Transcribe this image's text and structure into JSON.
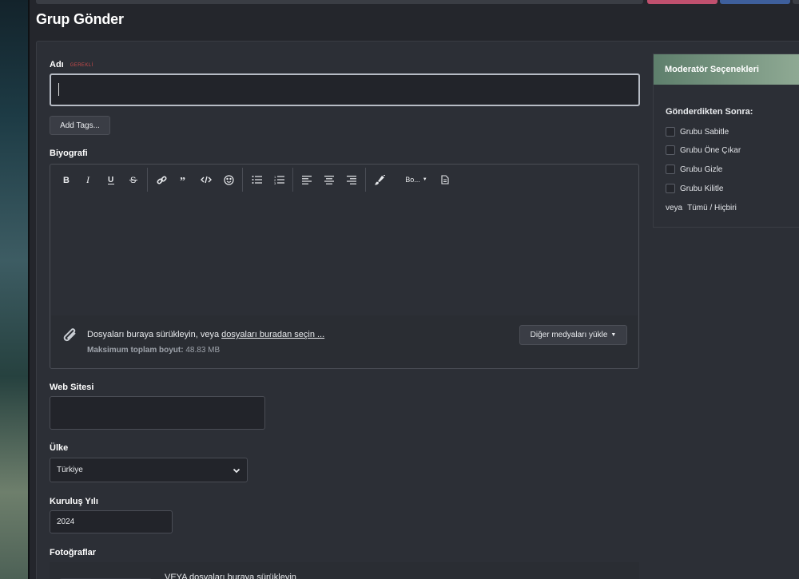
{
  "page": {
    "title": "Grup Gönder"
  },
  "form": {
    "name": {
      "label": "Adı",
      "required": "GEREKLİ",
      "value": ""
    },
    "add_tags": "Add Tags...",
    "bio": {
      "label": "Biyografi",
      "toolbar": {
        "font_dropdown": "Bo..."
      },
      "attach": {
        "drop_text": "Dosyaları buraya sürükleyin, veya",
        "choose_link": "dosyaları buradan seçin ...",
        "max_label": "Maksimum toplam boyut:",
        "max_value": "48.83 MB",
        "other_media_button": "Diğer medyaları yükle"
      }
    },
    "website": {
      "label": "Web Sitesi",
      "value": ""
    },
    "country": {
      "label": "Ülke",
      "value": "Türkiye"
    },
    "founded": {
      "label": "Kuruluş Yılı",
      "value": "2024"
    },
    "photos": {
      "label": "Fotoğraflar",
      "drop_text": "VEYA dosyaları buraya sürükleyin"
    }
  },
  "moderator": {
    "title": "Moderatör Seçenekleri",
    "after_label": "Gönderdikten Sonra:",
    "options": [
      "Grubu Sabitle",
      "Grubu Öne Çıkar",
      "Grubu Gizle",
      "Grubu Kilitle"
    ],
    "or_label": "veya",
    "all_none": "Tümü / Hiçbiri"
  },
  "colors": {
    "accent_pink": "#c0506e",
    "accent_blue": "#3e5f9c",
    "header_green": "#7e9c86"
  }
}
